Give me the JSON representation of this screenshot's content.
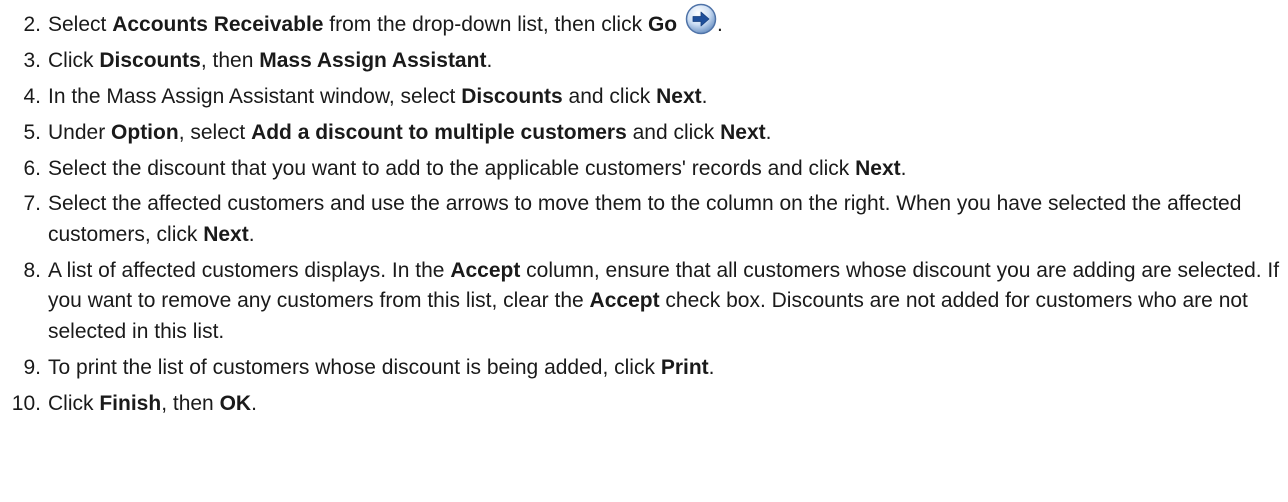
{
  "steps": [
    {
      "num": "2.",
      "parts": [
        {
          "t": "Select "
        },
        {
          "t": "Accounts Receivable",
          "b": true
        },
        {
          "t": " from the drop-down list, then click "
        },
        {
          "t": "Go",
          "b": true
        },
        {
          "t": " "
        },
        {
          "icon": "go-arrow-icon"
        },
        {
          "t": "."
        }
      ]
    },
    {
      "num": "3.",
      "parts": [
        {
          "t": "Click "
        },
        {
          "t": "Discounts",
          "b": true
        },
        {
          "t": ", then "
        },
        {
          "t": "Mass Assign Assistant",
          "b": true
        },
        {
          "t": "."
        }
      ]
    },
    {
      "num": "4.",
      "parts": [
        {
          "t": "In the Mass Assign Assistant window, select "
        },
        {
          "t": "Discounts",
          "b": true
        },
        {
          "t": " and click "
        },
        {
          "t": "Next",
          "b": true
        },
        {
          "t": "."
        }
      ]
    },
    {
      "num": "5.",
      "parts": [
        {
          "t": "Under "
        },
        {
          "t": "Option",
          "b": true
        },
        {
          "t": ", select "
        },
        {
          "t": "Add a discount to multiple customers",
          "b": true
        },
        {
          "t": " and click "
        },
        {
          "t": "Next",
          "b": true
        },
        {
          "t": "."
        }
      ]
    },
    {
      "num": "6.",
      "parts": [
        {
          "t": "Select the discount that you want to add to the applicable customers' records and click "
        },
        {
          "t": "Next",
          "b": true
        },
        {
          "t": "."
        }
      ]
    },
    {
      "num": "7.",
      "parts": [
        {
          "t": "Select the affected customers and use the arrows to move them to the column on the right. When you have selected the affected customers, click "
        },
        {
          "t": "Next",
          "b": true
        },
        {
          "t": "."
        }
      ]
    },
    {
      "num": "8.",
      "parts": [
        {
          "t": "A list of affected customers displays. In the "
        },
        {
          "t": "Accept",
          "b": true
        },
        {
          "t": " column, ensure that all customers whose discount you are adding are selected. If you want to remove any customers from this list, clear the "
        },
        {
          "t": "Accept",
          "b": true
        },
        {
          "t": " check box. Discounts are not added for customers who are not selected in this list."
        }
      ]
    },
    {
      "num": "9.",
      "parts": [
        {
          "t": "To print the list of customers whose discount is being added, click "
        },
        {
          "t": "Print",
          "b": true
        },
        {
          "t": "."
        }
      ]
    },
    {
      "num": "10.",
      "parts": [
        {
          "t": "Click "
        },
        {
          "t": "Finish",
          "b": true
        },
        {
          "t": ", then "
        },
        {
          "t": "OK",
          "b": true
        },
        {
          "t": "."
        }
      ]
    }
  ]
}
